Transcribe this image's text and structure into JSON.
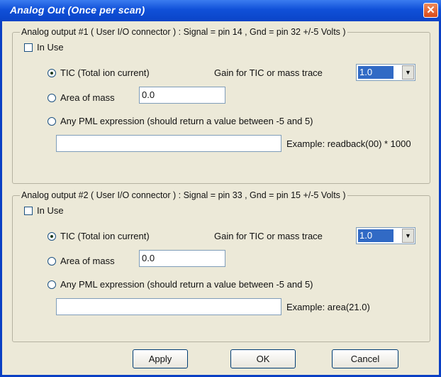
{
  "window": {
    "title": "Analog Out (Once per scan)",
    "close_glyph": "✕"
  },
  "group1": {
    "legend": "Analog output #1 ( User I/O connector ) : Signal = pin 14 , Gnd = pin 32 +/-5 Volts )",
    "in_use_label": "In Use",
    "tic_label": "TIC (Total ion current)",
    "gain_label": "Gain for TIC or mass trace",
    "gain_value": "1.0",
    "area_label": "Area of mass",
    "area_value": "0.0",
    "pml_label": "Any PML expression  (should return a value between -5 and 5)",
    "pml_value": "",
    "example_label": "Example: readback(00) * 1000"
  },
  "group2": {
    "legend": "Analog output #2 ( User I/O connector ) : Signal = pin 33 , Gnd = pin 15 +/-5 Volts )",
    "in_use_label": "In Use",
    "tic_label": "TIC (Total ion current)",
    "gain_label": "Gain for TIC or mass trace",
    "gain_value": "1.0",
    "area_label": "Area of mass",
    "area_value": "0.0",
    "pml_label": "Any PML expression  (should return a value between -5 and 5)",
    "pml_value": "",
    "example_label": "Example: area(21.0)"
  },
  "buttons": {
    "apply": "Apply",
    "ok": "OK",
    "cancel": "Cancel"
  }
}
